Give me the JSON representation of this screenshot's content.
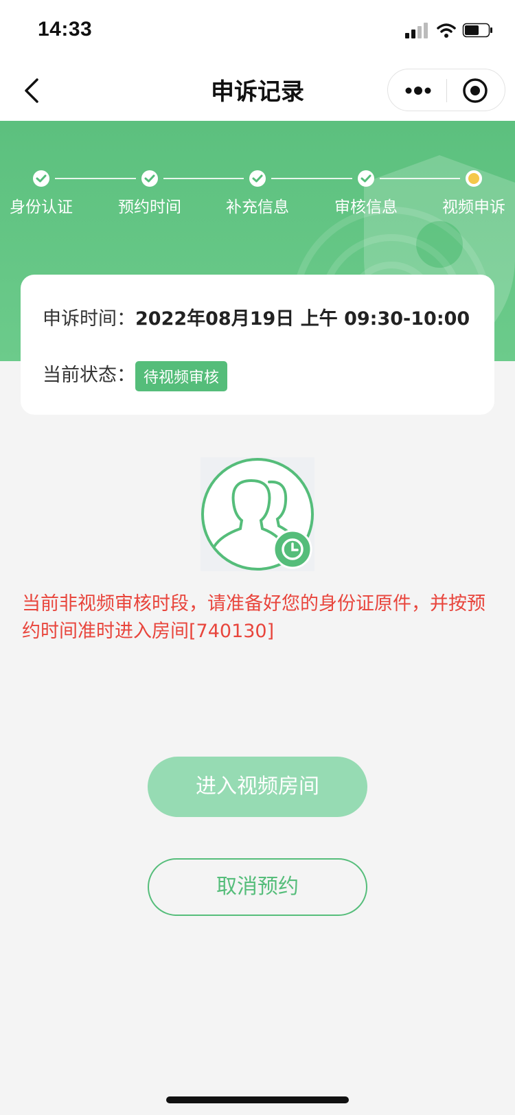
{
  "status_bar": {
    "time": "14:33"
  },
  "nav": {
    "title": "申诉记录"
  },
  "steps": [
    {
      "label": "身份认证",
      "state": "done"
    },
    {
      "label": "预约时间",
      "state": "done"
    },
    {
      "label": "补充信息",
      "state": "done"
    },
    {
      "label": "审核信息",
      "state": "done"
    },
    {
      "label": "视频申诉",
      "state": "current"
    }
  ],
  "card": {
    "time_label": "申诉时间：",
    "time_value": "2022年08月19日 上午 09:30-10:00",
    "status_label": "当前状态：",
    "status_value": "待视频审核"
  },
  "notice": "当前非视频审核时段，请准备好您的身份证原件，并按预约时间准时进入房间[740130]",
  "buttons": {
    "enter_room": "进入视频房间",
    "cancel": "取消预约"
  },
  "colors": {
    "brand_green": "#55bd7a",
    "hero_green": "#5cc07e",
    "warning_red": "#e8453c",
    "current_step": "#f5c84a"
  },
  "icons": {
    "back": "chevron-left-icon",
    "more": "more-dots-icon",
    "mini_target": "target-icon",
    "avatar": "users-clock-icon",
    "check": "check-icon"
  }
}
